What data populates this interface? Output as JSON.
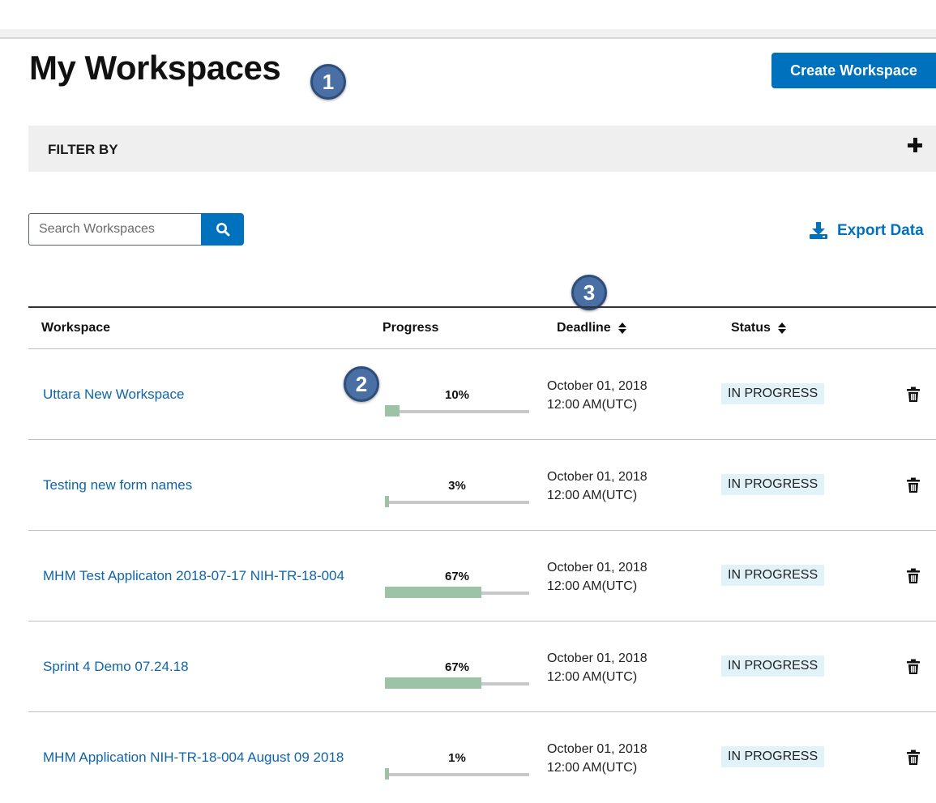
{
  "page": {
    "title": "My Workspaces",
    "create_button": "Create Workspace"
  },
  "annotations": [
    "1",
    "2",
    "3"
  ],
  "filter": {
    "label": "FILTER BY",
    "toggle_icon": "plus-icon"
  },
  "search": {
    "placeholder": "Search Workspaces",
    "value": "",
    "button_icon": "search-icon"
  },
  "export": {
    "label": "Export Data",
    "icon": "download-icon"
  },
  "table": {
    "headers": {
      "workspace": "Workspace",
      "progress": "Progress",
      "deadline": "Deadline",
      "status": "Status"
    },
    "rows": [
      {
        "name": "Uttara New Workspace",
        "progress_label": "10%",
        "progress": 10,
        "deadline_date": "October 01, 2018",
        "deadline_time": "12:00 AM(UTC)",
        "status": "IN PROGRESS"
      },
      {
        "name": "Testing new form names",
        "progress_label": "3%",
        "progress": 3,
        "deadline_date": "October 01, 2018",
        "deadline_time": "12:00 AM(UTC)",
        "status": "IN PROGRESS"
      },
      {
        "name": "MHM Test Applicaton 2018-07-17 NIH-TR-18-004",
        "progress_label": "67%",
        "progress": 67,
        "deadline_date": "October 01, 2018",
        "deadline_time": "12:00 AM(UTC)",
        "status": "IN PROGRESS"
      },
      {
        "name": "Sprint 4 Demo 07.24.18",
        "progress_label": "67%",
        "progress": 67,
        "deadline_date": "October 01, 2018",
        "deadline_time": "12:00 AM(UTC)",
        "status": "IN PROGRESS"
      },
      {
        "name": "MHM Application NIH-TR-18-004 August 09 2018",
        "progress_label": "1%",
        "progress": 1,
        "deadline_date": "October 01, 2018",
        "deadline_time": "12:00 AM(UTC)",
        "status": "IN PROGRESS"
      }
    ]
  },
  "colors": {
    "primary": "#0071bc",
    "link": "#0f65a8",
    "progress_fill": "#9cc3a5",
    "status_bg": "#e1f3f8",
    "badge": "#4a6fa5"
  }
}
